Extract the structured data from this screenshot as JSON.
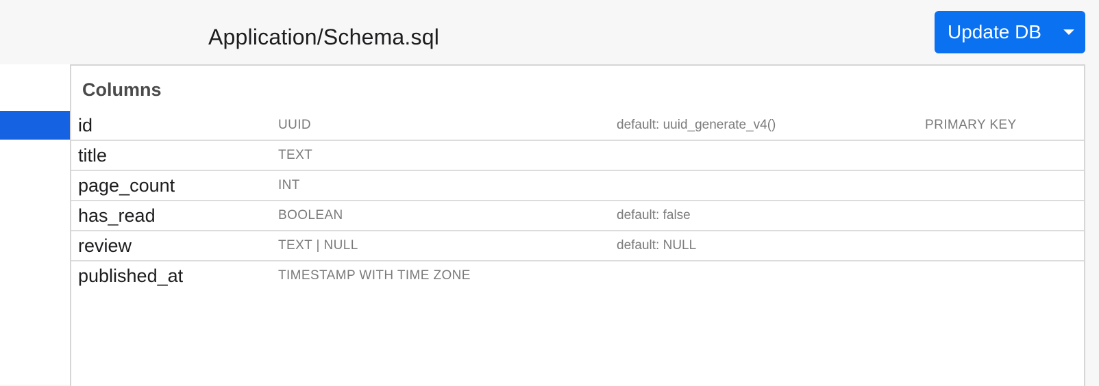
{
  "header": {
    "file_title": "Application/Schema.sql",
    "update_button_label": "Update DB",
    "accent_color": "#0a72f1"
  },
  "panel": {
    "section_title": "Columns",
    "columns": [
      {
        "name": "id",
        "type": "UUID",
        "default": "default: uuid_generate_v4()",
        "constraint": "PRIMARY KEY"
      },
      {
        "name": "title",
        "type": "TEXT",
        "default": "",
        "constraint": ""
      },
      {
        "name": "page_count",
        "type": "INT",
        "default": "",
        "constraint": ""
      },
      {
        "name": "has_read",
        "type": "BOOLEAN",
        "default": "default: false",
        "constraint": ""
      },
      {
        "name": "review",
        "type": "TEXT | NULL",
        "default": "default: NULL",
        "constraint": ""
      },
      {
        "name": "published_at",
        "type": "TIMESTAMP WITH TIME ZONE",
        "default": "",
        "constraint": ""
      }
    ]
  },
  "sidebar": {
    "selected_color": "#1562e3"
  }
}
